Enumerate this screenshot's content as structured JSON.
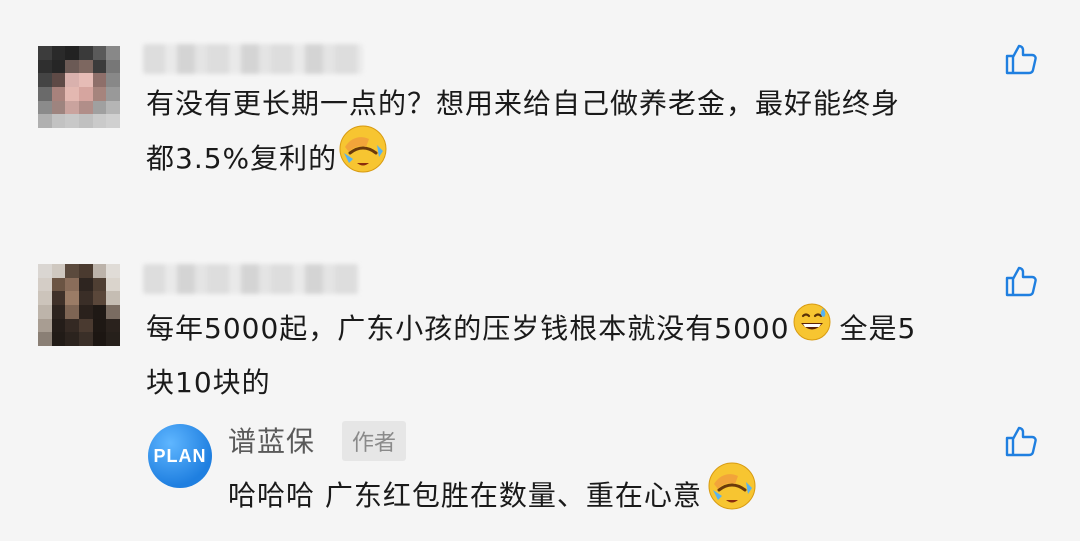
{
  "comments": [
    {
      "text_line1": "有没有更长期一点的？想用来给自己做养老金，最好能终身",
      "text_line2": "都3.5%复利的",
      "emoji": "facepalm-crying-emoji"
    },
    {
      "text_line1": "每年5000起，广东小孩的压岁钱根本就没有5000",
      "text_line1b": "全是5",
      "text_line2": "块10块的",
      "emoji": "grin-sweat-emoji"
    }
  ],
  "reply": {
    "avatar_text": "PLAN",
    "name": "谱蓝保",
    "tag": "作者",
    "text": "哈哈哈 广东红包胜在数量、重在心意",
    "emoji": "facepalm-crying-emoji"
  },
  "icons": {
    "like": "thumbs-up-icon"
  },
  "colors": {
    "background": "#f5f5f5",
    "brand_blue": "#1f7fe0",
    "emoji_yellow": "#f7c531"
  }
}
